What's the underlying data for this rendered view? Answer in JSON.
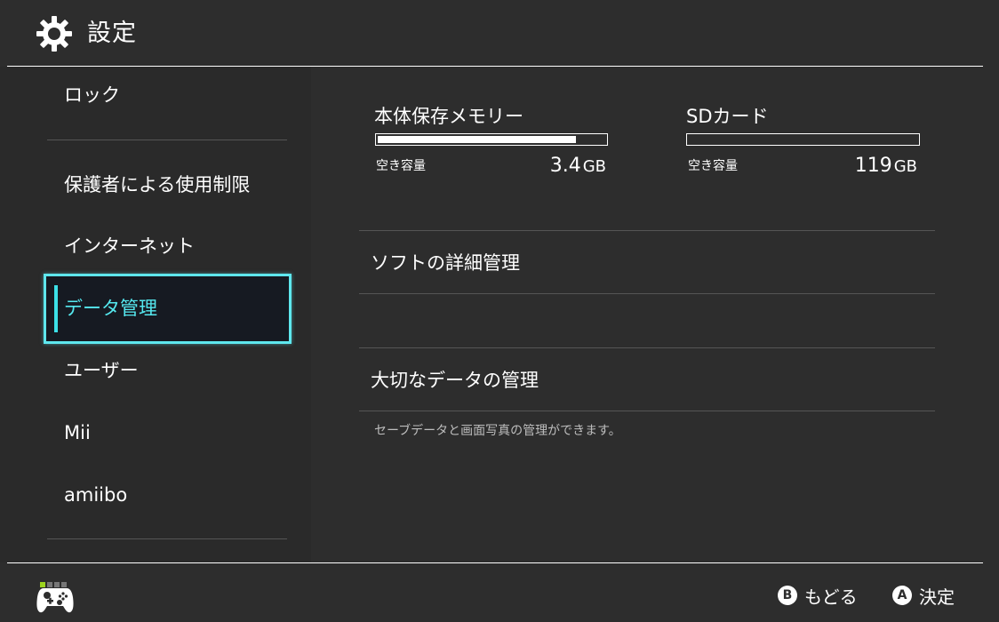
{
  "header": {
    "title": "設定",
    "icon": "gear-icon"
  },
  "sidebar": {
    "items": [
      {
        "label": "ロック"
      },
      {
        "label": "保護者による使用制限"
      },
      {
        "label": "インターネット"
      },
      {
        "label": "データ管理",
        "selected": true
      },
      {
        "label": "ユーザー"
      },
      {
        "label": "Mii"
      },
      {
        "label": "amiibo"
      }
    ],
    "accent_color": "#5ee7ee"
  },
  "storage": {
    "system": {
      "title": "本体保存メモリー",
      "free_label": "空き容量",
      "free_value": "3.4",
      "free_unit": "GB",
      "used_fraction": 0.87
    },
    "sd": {
      "title": "SDカード",
      "free_label": "空き容量",
      "free_value": "119",
      "free_unit": "GB",
      "used_fraction": 0.0
    }
  },
  "main": {
    "items": [
      {
        "label": "ソフトの詳細管理"
      },
      {
        "label": "大切なデータの管理",
        "description": "セーブデータと画面写真の管理ができます。"
      }
    ]
  },
  "footer": {
    "back": {
      "button": "B",
      "label": "もどる"
    },
    "confirm": {
      "button": "A",
      "label": "決定"
    },
    "controller_icon": "controller-icon",
    "active_player_color": "#9dd41f"
  }
}
